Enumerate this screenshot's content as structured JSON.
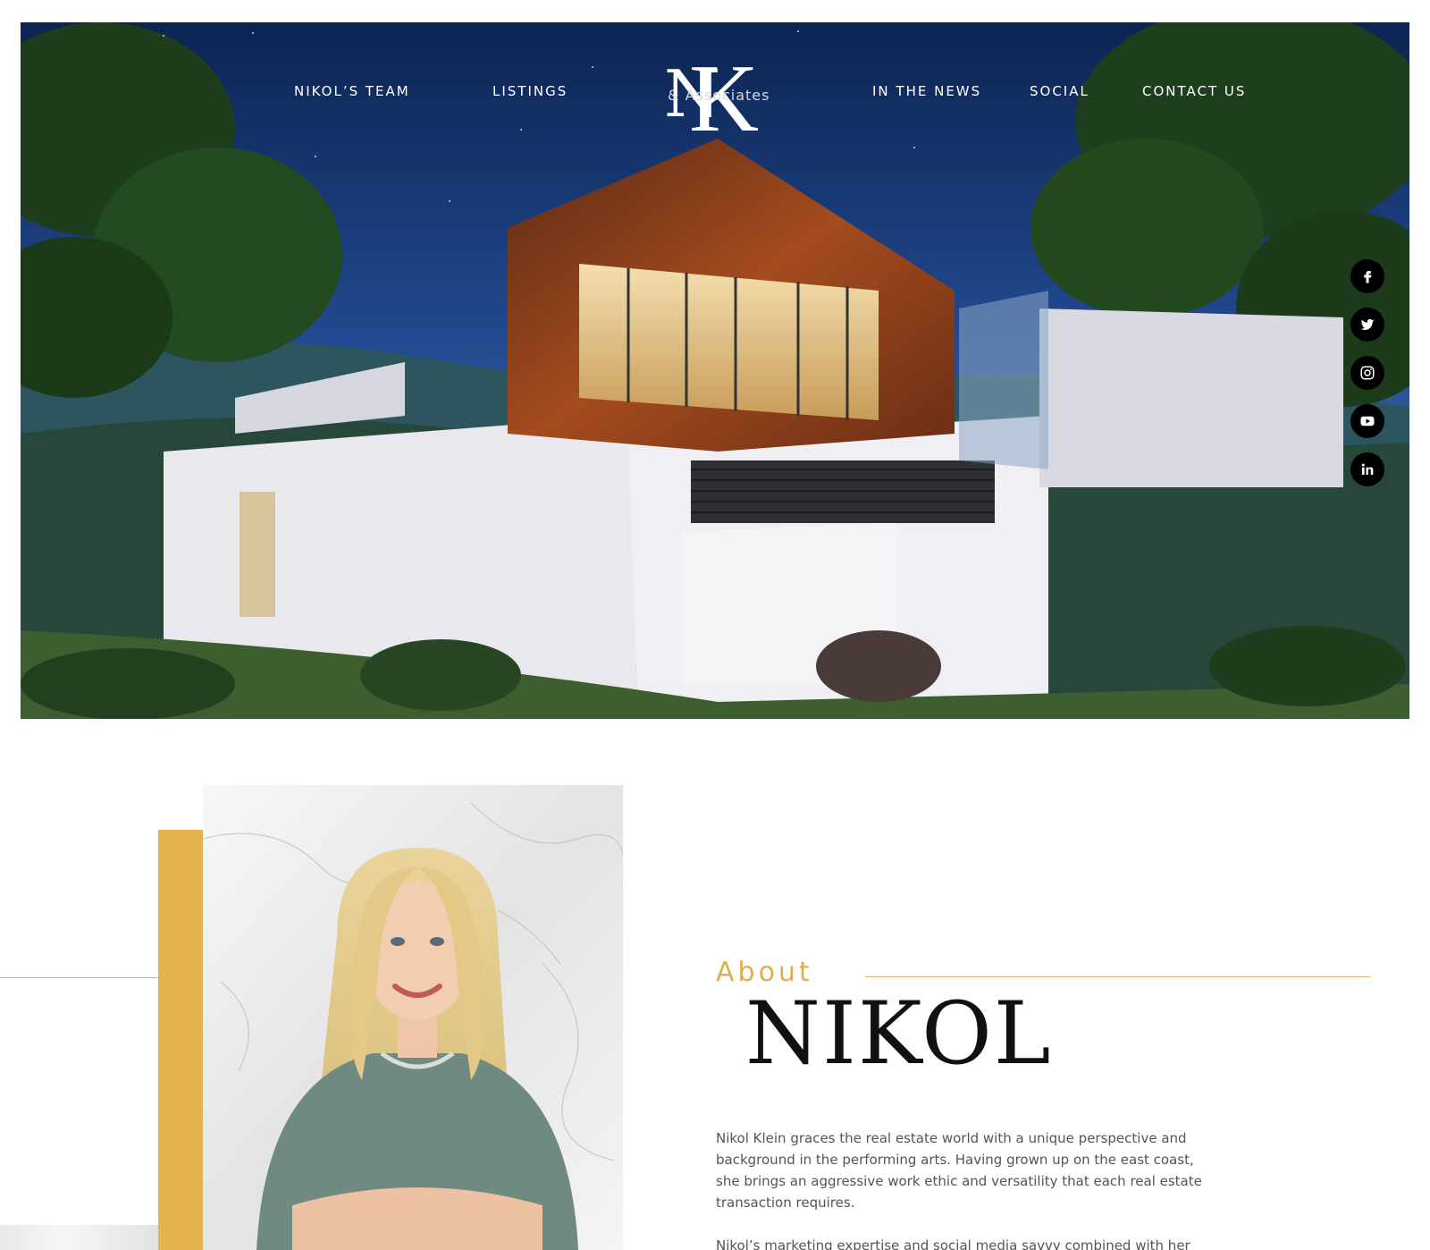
{
  "nav": {
    "left_items": [
      "NIKOL’S TEAM",
      "LISTINGS"
    ],
    "right_items": [
      "IN THE NEWS",
      "SOCIAL",
      "CONTACT US"
    ],
    "logo": {
      "letters_small": "N",
      "letters_large": "K",
      "subtitle": "& Associates"
    }
  },
  "social": [
    {
      "name": "facebook-icon"
    },
    {
      "name": "twitter-icon"
    },
    {
      "name": "instagram-icon"
    },
    {
      "name": "youtube-icon"
    },
    {
      "name": "linkedin-icon"
    }
  ],
  "about": {
    "label": "About",
    "name": "NIKOL",
    "bio": "Nikol Klein graces the real estate world with a unique perspective  and background in the performing arts. Having grown  up on the east coast, she brings an aggressive work ethic and  versatility that each real estate transaction requires.",
    "bio_second": "Nikol’s marketing  expertise and social media savvy combined with her"
  },
  "colors": {
    "accent_gold": "#e5b34c",
    "rule_gold": "#d8ad5d",
    "text_gray": "#555555",
    "social_bg": "#000000"
  }
}
